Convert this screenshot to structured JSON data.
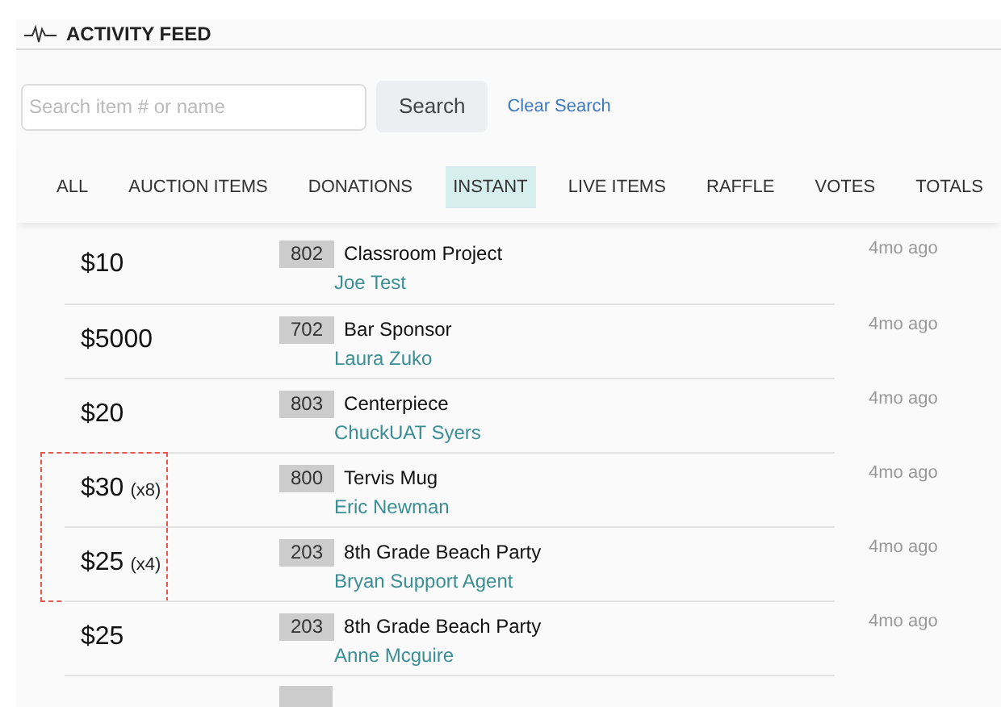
{
  "header": {
    "title": "ACTIVITY FEED"
  },
  "search": {
    "placeholder": "Search item # or name",
    "button": "Search",
    "clear": "Clear Search"
  },
  "tabs": [
    {
      "label": "ALL",
      "selected": false
    },
    {
      "label": "AUCTION ITEMS",
      "selected": false
    },
    {
      "label": "DONATIONS",
      "selected": false
    },
    {
      "label": "INSTANT",
      "selected": true
    },
    {
      "label": "LIVE ITEMS",
      "selected": false
    },
    {
      "label": "RAFFLE",
      "selected": false
    },
    {
      "label": "VOTES",
      "selected": false
    },
    {
      "label": "TOTALS",
      "selected": false
    }
  ],
  "rows": [
    {
      "amount": "$10",
      "item_number": "802",
      "item": "Classroom Project",
      "bidder": "Joe Test",
      "time": "4mo ago",
      "highlighted": false
    },
    {
      "amount": "$5000",
      "item_number": "702",
      "item": "Bar Sponsor",
      "bidder": "Laura Zuko",
      "time": "4mo ago",
      "highlighted": false
    },
    {
      "amount": "$20",
      "item_number": "803",
      "item": "Centerpiece",
      "bidder": "ChuckUAT Syers",
      "time": "4mo ago",
      "highlighted": false
    },
    {
      "amount": "$30",
      "quantity": "(x8)",
      "item_number": "800",
      "item": "Tervis Mug",
      "bidder": "Eric Newman",
      "time": "4mo ago",
      "highlighted": true
    },
    {
      "amount": "$25",
      "quantity": "(x4)",
      "item_number": "203",
      "item": "8th Grade Beach Party",
      "bidder": "Bryan Support Agent",
      "time": "4mo ago",
      "highlighted": true
    },
    {
      "amount": "$25",
      "item_number": "203",
      "item": "8th Grade Beach Party",
      "bidder": "Anne Mcguire",
      "time": "4mo ago",
      "highlighted": false
    }
  ]
}
